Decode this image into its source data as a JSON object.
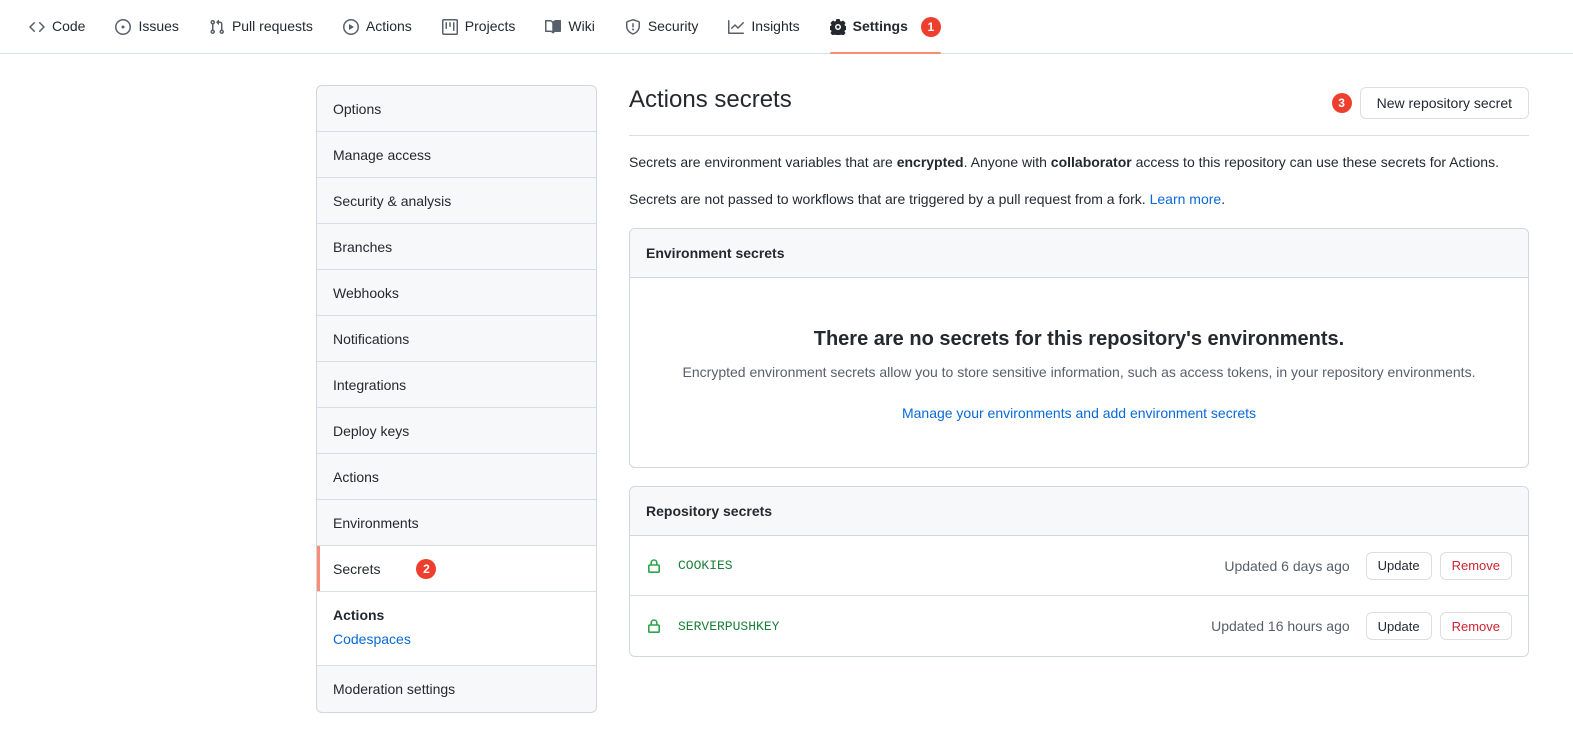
{
  "repo_nav": {
    "items": [
      {
        "label": "Code",
        "icon": "code-icon",
        "selected": false,
        "badge": null
      },
      {
        "label": "Issues",
        "icon": "issue-opened-icon",
        "selected": false,
        "badge": null
      },
      {
        "label": "Pull requests",
        "icon": "git-pull-request-icon",
        "selected": false,
        "badge": null
      },
      {
        "label": "Actions",
        "icon": "play-icon",
        "selected": false,
        "badge": null
      },
      {
        "label": "Projects",
        "icon": "project-icon",
        "selected": false,
        "badge": null
      },
      {
        "label": "Wiki",
        "icon": "book-icon",
        "selected": false,
        "badge": null
      },
      {
        "label": "Security",
        "icon": "shield-icon",
        "selected": false,
        "badge": null
      },
      {
        "label": "Insights",
        "icon": "graph-icon",
        "selected": false,
        "badge": null
      },
      {
        "label": "Settings",
        "icon": "gear-icon",
        "selected": true,
        "badge": "1"
      }
    ]
  },
  "sidebar": {
    "items": [
      {
        "label": "Options",
        "active": false,
        "badge": null
      },
      {
        "label": "Manage access",
        "active": false,
        "badge": null
      },
      {
        "label": "Security & analysis",
        "active": false,
        "badge": null
      },
      {
        "label": "Branches",
        "active": false,
        "badge": null
      },
      {
        "label": "Webhooks",
        "active": false,
        "badge": null
      },
      {
        "label": "Notifications",
        "active": false,
        "badge": null
      },
      {
        "label": "Integrations",
        "active": false,
        "badge": null
      },
      {
        "label": "Deploy keys",
        "active": false,
        "badge": null
      },
      {
        "label": "Actions",
        "active": false,
        "badge": null
      },
      {
        "label": "Environments",
        "active": false,
        "badge": null
      },
      {
        "label": "Secrets",
        "active": true,
        "badge": "2"
      }
    ],
    "sub_items": [
      {
        "label": "Actions",
        "current": true
      },
      {
        "label": "Codespaces",
        "current": false
      }
    ],
    "last_item": {
      "label": "Moderation settings"
    }
  },
  "main": {
    "title": "Actions secrets",
    "new_secret_badge": "3",
    "new_secret_label": "New repository secret",
    "intro_line1_a": "Secrets are environment variables that are ",
    "intro_line1_bold1": "encrypted",
    "intro_line1_b": ". Anyone with ",
    "intro_line1_bold2": "collaborator",
    "intro_line1_c": " access to this repository can use these secrets for Actions.",
    "intro_line2_a": "Secrets are not passed to workflows that are triggered by a pull request from a fork. ",
    "intro_line2_link": "Learn more",
    "intro_line2_b": ".",
    "environment_secrets": {
      "header": "Environment secrets",
      "empty_title": "There are no secrets for this repository's environments.",
      "empty_desc": "Encrypted environment secrets allow you to store sensitive information, such as access tokens, in your repository environments.",
      "empty_link": "Manage your environments and add environment secrets"
    },
    "repository_secrets": {
      "header": "Repository secrets",
      "rows": [
        {
          "name": "COOKIES",
          "updated": "Updated 6 days ago",
          "update_label": "Update",
          "remove_label": "Remove"
        },
        {
          "name": "SERVERPUSHKEY",
          "updated": "Updated 16 hours ago",
          "update_label": "Update",
          "remove_label": "Remove"
        }
      ]
    }
  },
  "colors": {
    "accent_blue": "#0969da",
    "badge_red": "#ee3f2e",
    "danger_red": "#cf222e",
    "active_orange": "#fd8c73",
    "secret_green": "#1a7f37"
  }
}
